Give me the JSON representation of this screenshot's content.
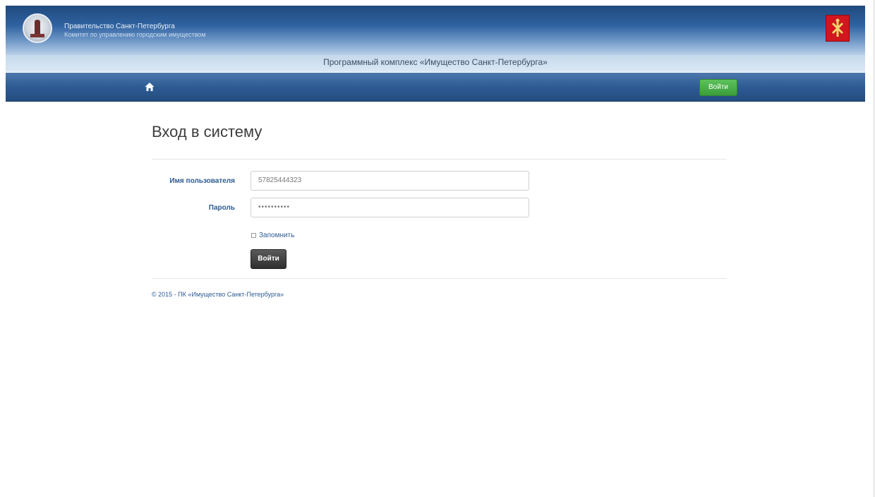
{
  "header": {
    "government_line1": "Правительство Санкт-Петербурга",
    "government_line2": "Комитет по управлению городским имуществом",
    "app_subtitle": "Программный комплекс «Имущество Санкт-Петербурга»"
  },
  "navbar": {
    "home_icon": "home-icon",
    "login_button": "Войти"
  },
  "login_form": {
    "title": "Вход в систему",
    "username_label": "Имя пользователя",
    "username_value": "57825444323",
    "password_label": "Пароль",
    "password_value": "••••••••••",
    "remember_label": "Запомнить",
    "submit_label": "Войти"
  },
  "footer": {
    "text": "© 2015 - ПК «Имущество Санкт-Петербурга»"
  },
  "colors": {
    "nav_blue": "#2d5b93",
    "login_green": "#4bb04b",
    "flag_red": "#d0161f"
  }
}
